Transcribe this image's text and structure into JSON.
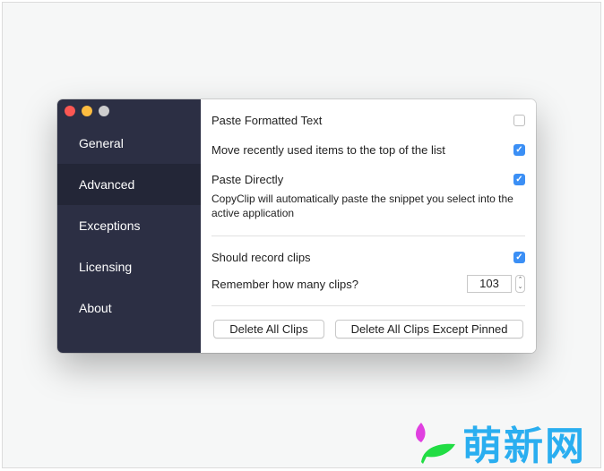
{
  "window": {
    "controls": [
      "close",
      "minimize",
      "zoom"
    ]
  },
  "sidebar": {
    "items": [
      {
        "label": "General",
        "active": false
      },
      {
        "label": "Advanced",
        "active": true
      },
      {
        "label": "Exceptions",
        "active": false
      },
      {
        "label": "Licensing",
        "active": false
      },
      {
        "label": "About",
        "active": false
      }
    ]
  },
  "settings": {
    "paste_formatted": {
      "label": "Paste Formatted Text",
      "checked": false
    },
    "move_recent": {
      "label": "Move recently used items to the top of the list",
      "checked": true
    },
    "paste_directly": {
      "label": "Paste Directly",
      "checked": true,
      "description": "CopyClip will automatically paste the snippet you select into the active application"
    },
    "record_clips": {
      "label": "Should record clips",
      "checked": true
    },
    "remember_count": {
      "label": "Remember how many clips?",
      "value": "103"
    }
  },
  "buttons": {
    "delete_all": "Delete All Clips",
    "delete_except_pinned": "Delete All Clips Except Pinned"
  },
  "icons": {
    "check": "✓",
    "stepper_up": "⌃",
    "stepper_down": "⌄"
  },
  "watermark": {
    "text": "萌新网"
  },
  "colors": {
    "sidebar_bg": "#2c2f44",
    "sidebar_active": "#232637",
    "checkbox_on": "#3b8ff5",
    "watermark_text": "#2aaef0"
  }
}
